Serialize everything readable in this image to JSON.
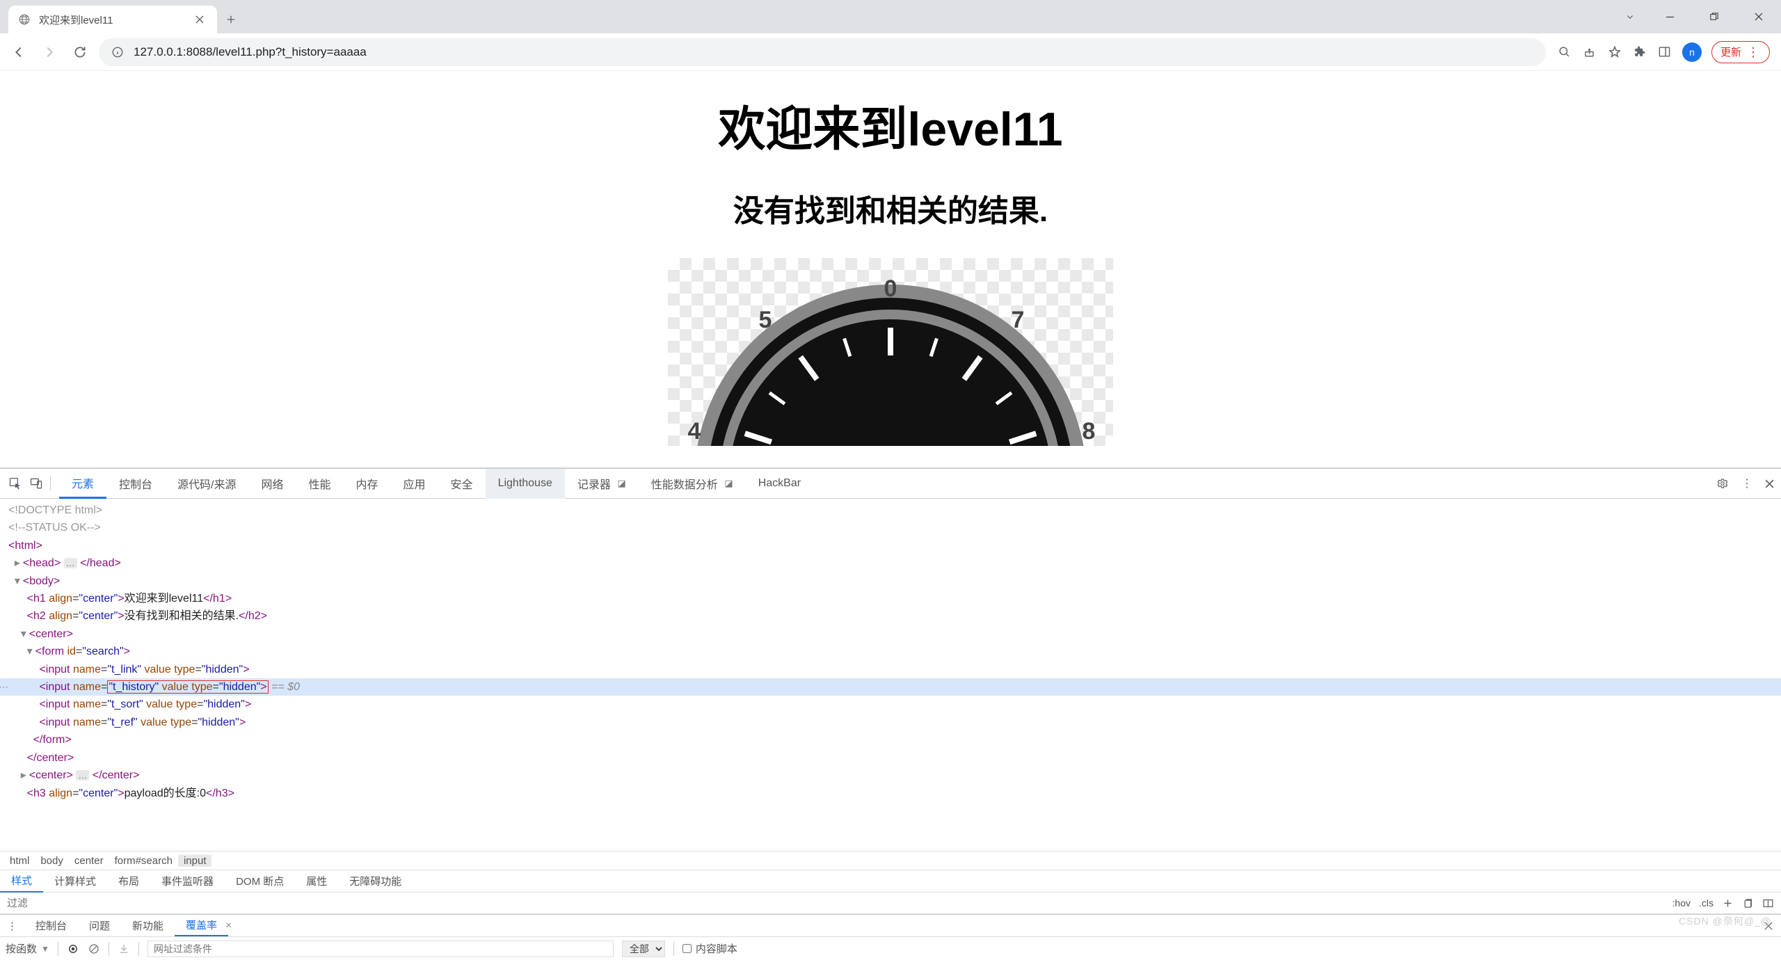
{
  "browser": {
    "tab_title": "欢迎来到level11",
    "url": "127.0.0.1:8088/level11.php?t_history=aaaaa",
    "update_label": "更新",
    "avatar_initial": "n"
  },
  "page": {
    "h1": "欢迎来到level11",
    "h2": "没有找到和相关的结果.",
    "gauge_numbers": {
      "n0": "0",
      "n5": "5",
      "n7": "7",
      "n4": "4",
      "n8": "8"
    }
  },
  "devtools": {
    "main_tabs": [
      "元素",
      "控制台",
      "源代码/来源",
      "网络",
      "性能",
      "内存",
      "应用",
      "安全",
      "Lighthouse",
      "记录器",
      "性能数据分析",
      "HackBar"
    ],
    "active_main": "元素",
    "gray_main": "Lighthouse",
    "dom": {
      "l1": "<!DOCTYPE html>",
      "l2": "<!--STATUS OK-->",
      "l3o": "<html>",
      "l4": "<head>…</head>",
      "l5o": "<body>",
      "l6a": "<h1 align=\"center\">",
      "l6t": "欢迎来到level11",
      "l6b": "</h1>",
      "l7a": "<h2 align=\"center\">",
      "l7t": "没有找到和相关的结果.",
      "l7b": "</h2>",
      "l8": "<center>",
      "l9": "<form id=\"search\">",
      "l10": "<input name=\"t_link\" value type=\"hidden\">",
      "l11a": "<input name=",
      "l11box": "\"t_history\" value type=\"hidden\">",
      "l11tail": " == $0",
      "l12": "<input name=\"t_sort\" value type=\"hidden\">",
      "l13": "<input name=\"t_ref\" value type=\"hidden\">",
      "l14": "</form>",
      "l15": "</center>",
      "l16": "<center>…</center>",
      "l17": "<h3 align=\"center\">payload的长度:0</h3>"
    },
    "breadcrumb": [
      "html",
      "body",
      "center",
      "form#search",
      "input"
    ],
    "styles_tabs": [
      "样式",
      "计算样式",
      "布局",
      "事件监听器",
      "DOM 断点",
      "属性",
      "无障碍功能"
    ],
    "styles_active": "样式",
    "filter_placeholder": "过滤",
    "filter_pills": {
      "hov": ":hov",
      "cls": ".cls"
    },
    "drawer_tabs": [
      "控制台",
      "问题",
      "新功能",
      "覆盖率"
    ],
    "drawer_active": "覆盖率",
    "coverage": {
      "dropdown": "按函数",
      "url_placeholder": "网址过滤条件",
      "select": "全部",
      "checkbox_label": "内容脚本"
    },
    "watermark": "CSDN @奈何@_@"
  }
}
